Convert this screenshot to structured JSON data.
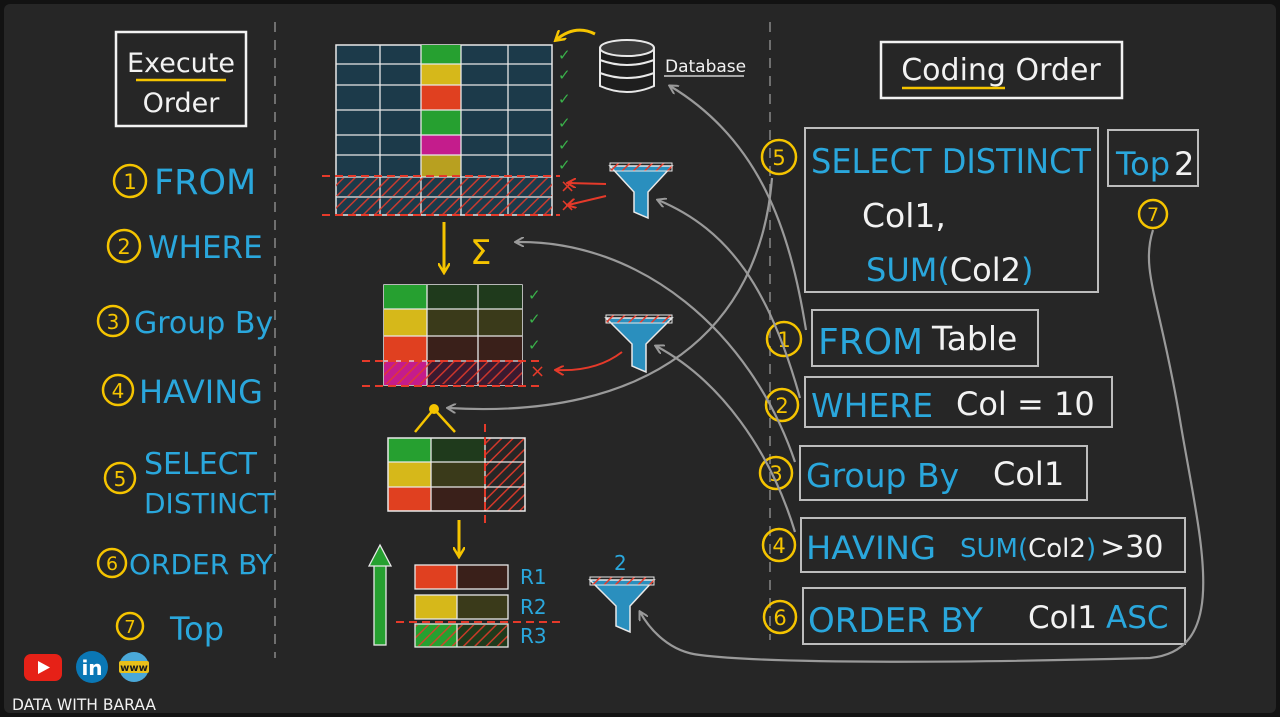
{
  "colors": {
    "background": "#262626",
    "frame": "#121212",
    "blue": "#2aa7dc",
    "yellow": "#f5c400",
    "white": "#f2f2f2",
    "red": "#e53a2a",
    "green": "#3ab24a",
    "gray": "#8c8c8c"
  },
  "execute_order": {
    "title_line1": "Execute",
    "title_line2": "Order",
    "steps": [
      {
        "num": "1",
        "label": "FROM"
      },
      {
        "num": "2",
        "label": "WHERE"
      },
      {
        "num": "3",
        "label": "Group By"
      },
      {
        "num": "4",
        "label": "HAVING"
      },
      {
        "num": "5",
        "label_line1": "SELECT",
        "label_line2": "DISTINCT"
      },
      {
        "num": "6",
        "label": "ORDER BY"
      },
      {
        "num": "7",
        "label": "Top"
      }
    ]
  },
  "diagram": {
    "database_label": "Database",
    "sum_symbol": "Σ",
    "check": "✓",
    "cross": "×",
    "row_labels": [
      "R1",
      "R2",
      "R3"
    ],
    "top_filter_value": "2"
  },
  "coding_order": {
    "title": "Coding Order",
    "select": {
      "num": "5",
      "keyword": "SELECT DISTINCT",
      "col1": "Col1,",
      "sum_fn": "SUM(",
      "sum_col": "Col2",
      "sum_close": ")"
    },
    "top": {
      "keyword": "Top",
      "value": "2",
      "num": "7"
    },
    "clauses": [
      {
        "num": "1",
        "keyword": "FROM",
        "rest": "Table"
      },
      {
        "num": "2",
        "keyword": "WHERE",
        "rest": "Col = 10"
      },
      {
        "num": "3",
        "keyword": "Group By",
        "rest": "Col1"
      },
      {
        "num": "4",
        "keyword": "HAVING",
        "fn": "SUM(",
        "arg": "Col2",
        "close": ")",
        "rest": ">30"
      },
      {
        "num": "6",
        "keyword": "ORDER BY",
        "rest": "Col1",
        "tail": "ASC"
      }
    ]
  },
  "branding": {
    "youtube_icon": "youtube-icon",
    "linkedin_icon": "linkedin-icon",
    "web_icon": "web-icon",
    "linkedin_text": "in",
    "web_text": "www",
    "brand_text": "DATA WITH BARAA"
  }
}
